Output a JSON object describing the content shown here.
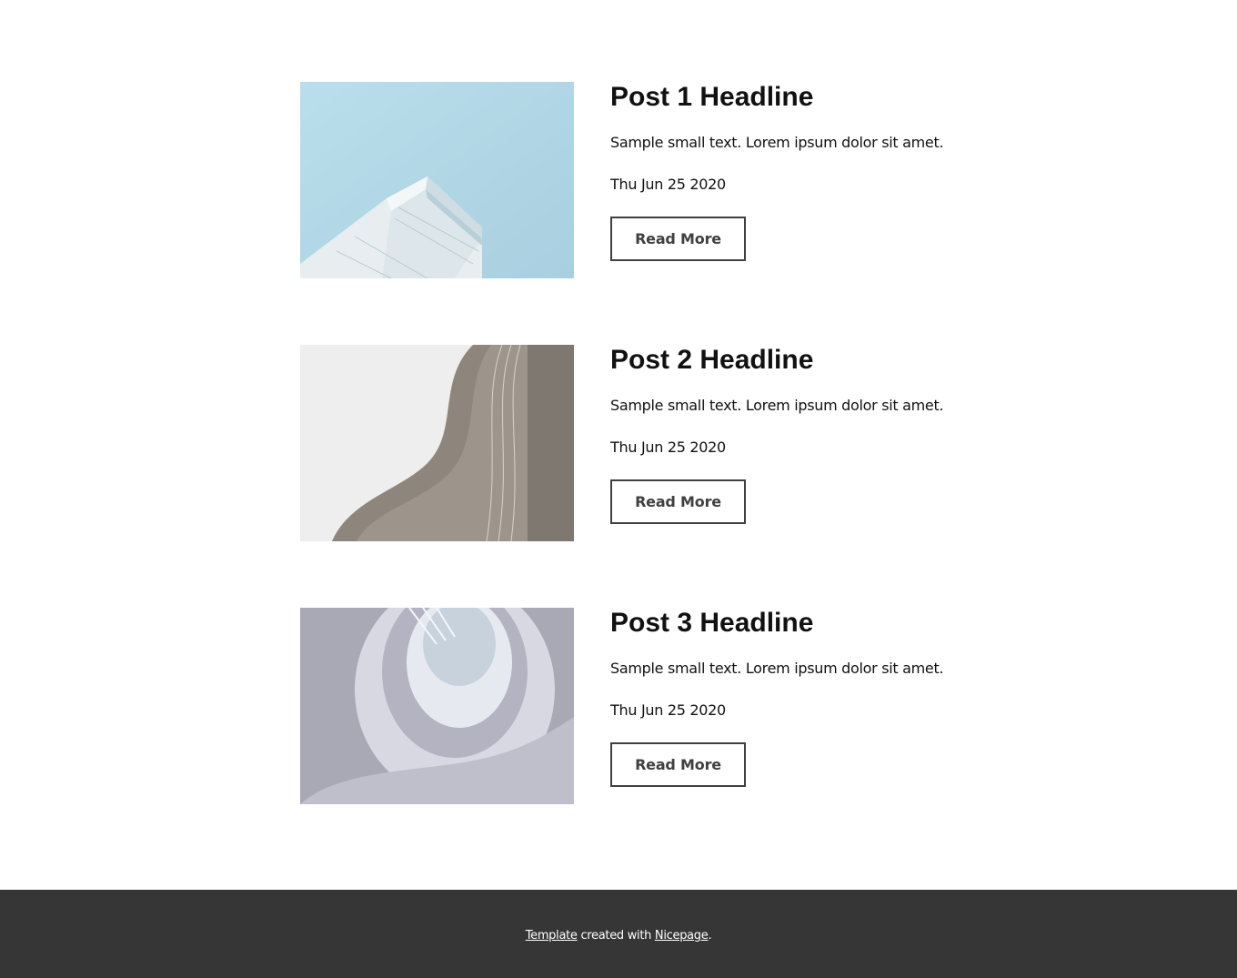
{
  "posts": [
    {
      "title": "Post 1 Headline",
      "text": "Sample small text. Lorem ipsum dolor sit amet.",
      "date": "Thu Jun 25 2020",
      "button_label": "Read More",
      "image": "building-against-sky"
    },
    {
      "title": "Post 2 Headline",
      "text": "Sample small text. Lorem ipsum dolor sit amet.",
      "date": "Thu Jun 25 2020",
      "button_label": "Read More",
      "image": "curved-facade"
    },
    {
      "title": "Post 3 Headline",
      "text": "Sample small text. Lorem ipsum dolor sit amet.",
      "date": "Thu Jun 25 2020",
      "button_label": "Read More",
      "image": "spiral-staircase"
    }
  ],
  "footer": {
    "template_link": "Template",
    "middle_text": " created with ",
    "nicepage_link": "Nicepage",
    "end_text": "."
  },
  "colors": {
    "footer_bg": "#363636",
    "button_border": "#404040",
    "text": "#111111"
  }
}
